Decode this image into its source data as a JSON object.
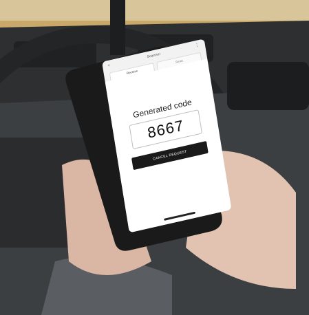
{
  "app": {
    "header_title": "Scanner",
    "tabs": [
      {
        "label": "Receive",
        "active": true
      },
      {
        "label": "Send",
        "active": false
      }
    ]
  },
  "code_panel": {
    "heading": "Generated code",
    "code": "8667",
    "cancel_label": "CANCEL REQUEST"
  },
  "colors": {
    "button_bg": "#1a1a1a",
    "screen_bg": "#ffffff"
  }
}
